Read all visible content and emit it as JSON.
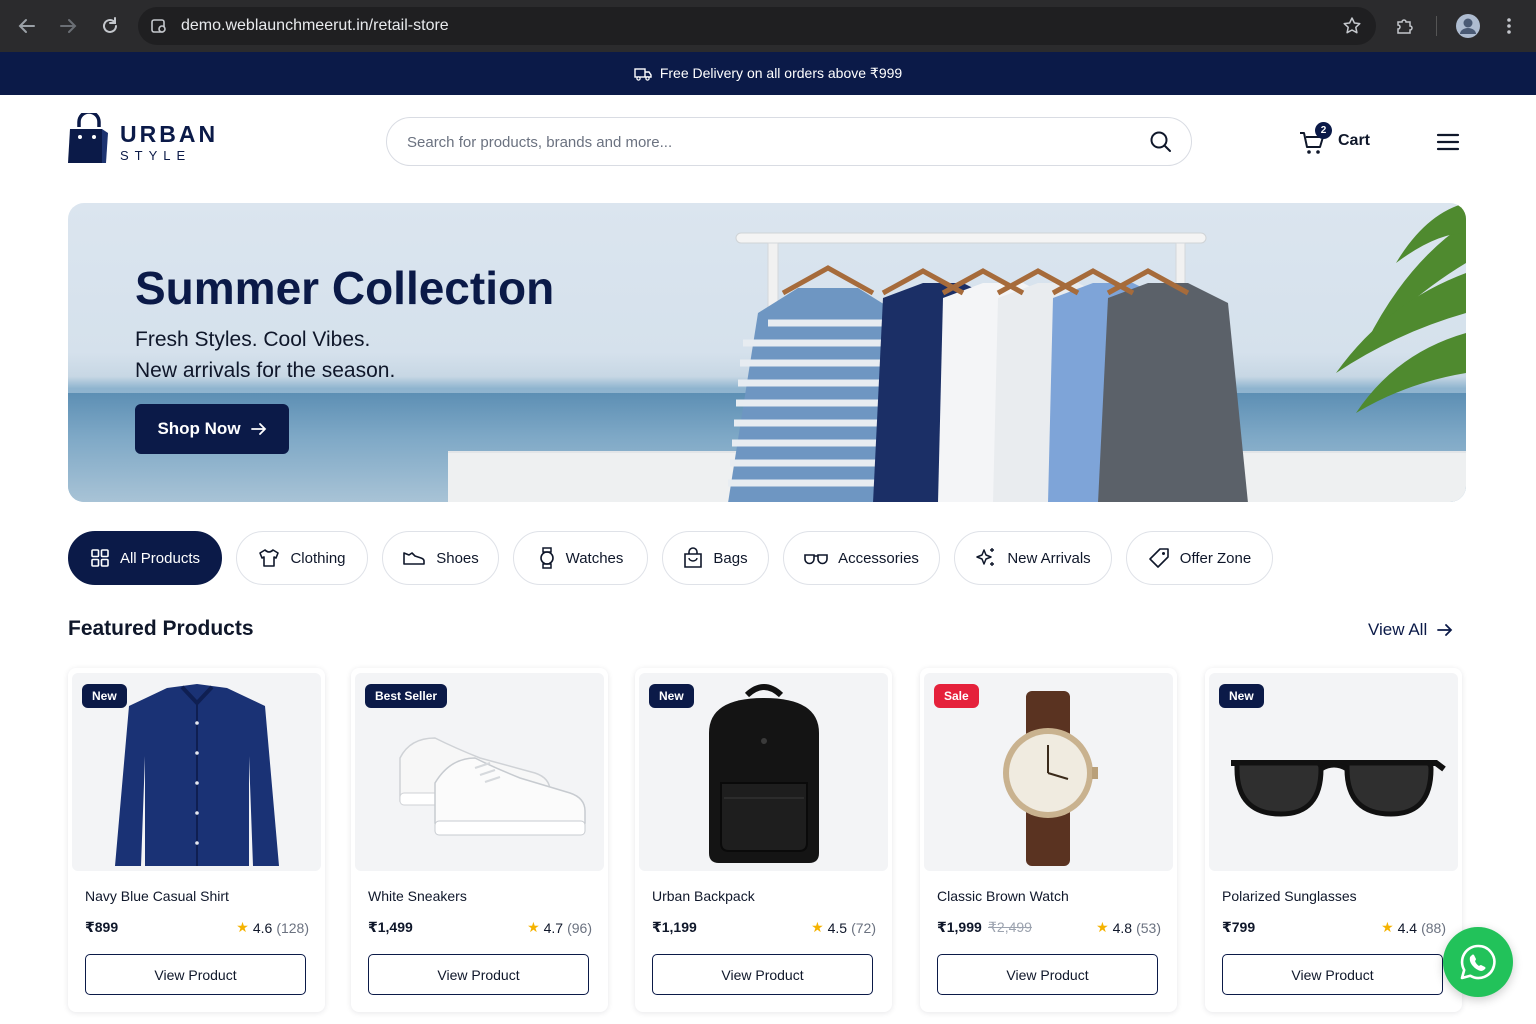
{
  "browser": {
    "url": "demo.weblaunchmeerut.in/retail-store"
  },
  "promo": {
    "text": "Free Delivery on all orders above ₹999"
  },
  "header": {
    "logo_line1": "URBAN",
    "logo_line2": "STYLE",
    "search_placeholder": "Search for products, brands and more...",
    "cart_label": "Cart",
    "cart_count": "2"
  },
  "hero": {
    "title": "Summer Collection",
    "subtitle_1": "Fresh Styles. Cool Vibes.",
    "subtitle_2": "New arrivals for the season.",
    "cta": "Shop Now"
  },
  "categories": [
    {
      "label": "All Products",
      "icon": "grid-icon",
      "active": true
    },
    {
      "label": "Clothing",
      "icon": "shirt-icon",
      "active": false
    },
    {
      "label": "Shoes",
      "icon": "shoe-icon",
      "active": false
    },
    {
      "label": "Watches",
      "icon": "watch-icon",
      "active": false
    },
    {
      "label": "Bags",
      "icon": "bag-icon",
      "active": false
    },
    {
      "label": "Accessories",
      "icon": "glasses-icon",
      "active": false
    },
    {
      "label": "New Arrivals",
      "icon": "sparkle-icon",
      "active": false
    },
    {
      "label": "Offer Zone",
      "icon": "tag-icon",
      "active": false
    }
  ],
  "featured": {
    "title": "Featured Products",
    "view_all": "View All"
  },
  "products": [
    {
      "badge": "New",
      "name": "Navy Blue Casual Shirt",
      "price": "₹899",
      "old_price": "",
      "rating": "4.6",
      "reviews": "(128)",
      "button": "View Product"
    },
    {
      "badge": "Best Seller",
      "name": "White Sneakers",
      "price": "₹1,499",
      "old_price": "",
      "rating": "4.7",
      "reviews": "(96)",
      "button": "View Product"
    },
    {
      "badge": "New",
      "name": "Urban Backpack",
      "price": "₹1,199",
      "old_price": "",
      "rating": "4.5",
      "reviews": "(72)",
      "button": "View Product"
    },
    {
      "badge": "Sale",
      "name": "Classic Brown Watch",
      "price": "₹1,999",
      "old_price": "₹2,499",
      "rating": "4.8",
      "reviews": "(53)",
      "button": "View Product"
    },
    {
      "badge": "New",
      "name": "Polarized Sunglasses",
      "price": "₹799",
      "old_price": "",
      "rating": "4.4",
      "reviews": "(88)",
      "button": "View Product"
    }
  ],
  "colors": {
    "brand_navy": "#0b1a48",
    "sale_red": "#e5213b",
    "star_gold": "#f5b301",
    "whatsapp_green": "#22c25a"
  }
}
